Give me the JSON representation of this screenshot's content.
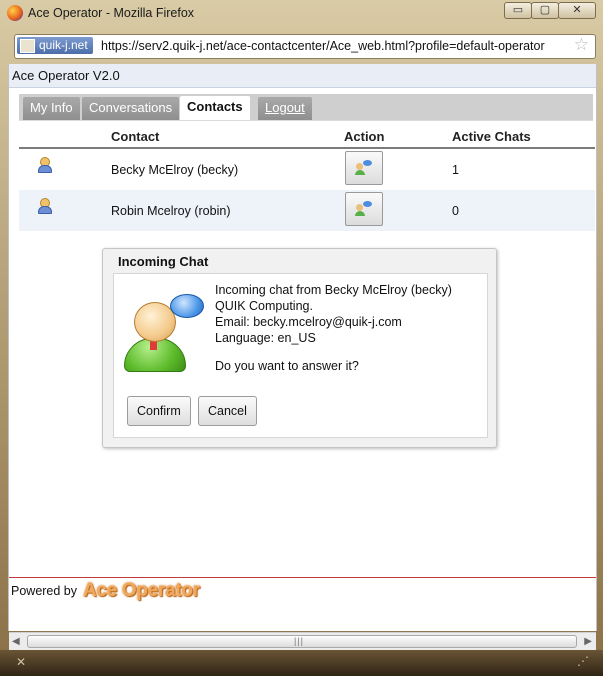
{
  "window": {
    "title": "Ace Operator - Mozilla Firefox",
    "controls": {
      "minimize": "▭",
      "maximize": "▢",
      "close": "✕"
    }
  },
  "urlbar": {
    "site_badge": "quik-j.net",
    "url": "https://serv2.quik-j.net/ace-contactcenter/Ace_web.html?profile=default-operator",
    "bookmark_icon": "star-icon"
  },
  "app": {
    "title": "Ace Operator V2.0"
  },
  "tabs": [
    {
      "label": "My Info"
    },
    {
      "label": "Conversations"
    },
    {
      "label": "Contacts"
    },
    {
      "label": "Logout"
    }
  ],
  "contacts_table": {
    "headers": {
      "contact": "Contact",
      "action": "Action",
      "active_chats": "Active Chats"
    },
    "rows": [
      {
        "contact": "Becky McElroy (becky)",
        "active_chats": "1"
      },
      {
        "contact": "Robin Mcelroy (robin)",
        "active_chats": "0"
      }
    ]
  },
  "dialog": {
    "title": "Incoming Chat",
    "lines": [
      "Incoming chat from Becky McElroy (becky)",
      "QUIK Computing.",
      "Email: becky.mcelroy@quik-j.com",
      "Language: en_US"
    ],
    "question": "Do you want to answer it?",
    "confirm_label": "Confirm",
    "cancel_label": "Cancel"
  },
  "footer": {
    "powered_by": "Powered by",
    "brand": "Ace Operator"
  },
  "scrollbar": {
    "left_arrow": "◀",
    "right_arrow": "▶",
    "grip": "|||"
  },
  "statusbar": {
    "close_glyph": "✕",
    "resize_glyph": "⋰"
  },
  "colors": {
    "accent_red": "#c23a3a",
    "header_blue": "#e8edf6",
    "brand_orange": "#f2a85a"
  }
}
